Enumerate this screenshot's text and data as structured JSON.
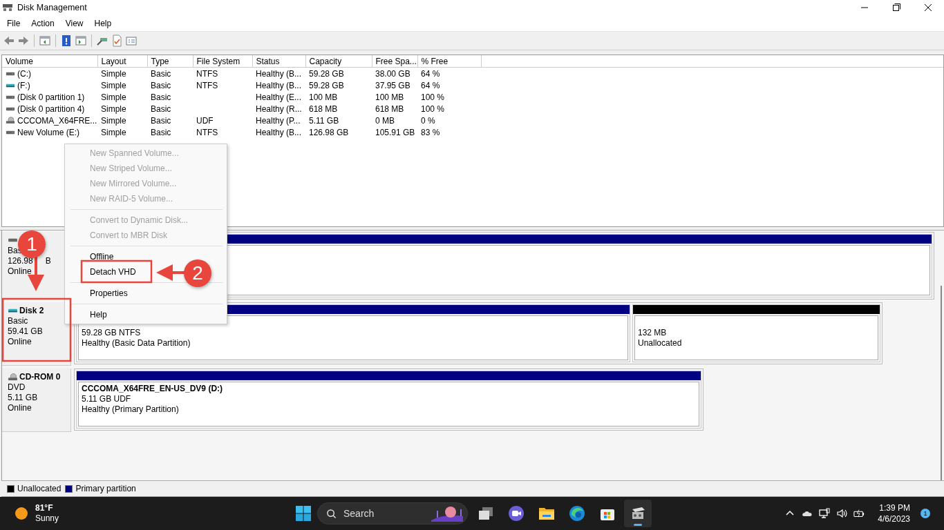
{
  "window": {
    "title": "Disk Management"
  },
  "menu": [
    "File",
    "Action",
    "View",
    "Help"
  ],
  "volumes": {
    "columns": [
      "Volume",
      "Layout",
      "Type",
      "File System",
      "Status",
      "Capacity",
      "Free Spa...",
      "% Free"
    ],
    "rows": [
      {
        "kind": "disk",
        "cells": [
          "(C:)",
          "Simple",
          "Basic",
          "NTFS",
          "Healthy (B...",
          "59.28 GB",
          "38.00 GB",
          "64 %"
        ]
      },
      {
        "kind": "vhd",
        "cells": [
          "(F:)",
          "Simple",
          "Basic",
          "NTFS",
          "Healthy (B...",
          "59.28 GB",
          "37.95 GB",
          "64 %"
        ]
      },
      {
        "kind": "disk",
        "cells": [
          "(Disk 0 partition 1)",
          "Simple",
          "Basic",
          "",
          "Healthy (E...",
          "100 MB",
          "100 MB",
          "100 %"
        ]
      },
      {
        "kind": "disk",
        "cells": [
          "(Disk 0 partition 4)",
          "Simple",
          "Basic",
          "",
          "Healthy (R...",
          "618 MB",
          "618 MB",
          "100 %"
        ]
      },
      {
        "kind": "cdrom",
        "cells": [
          "CCCOMA_X64FRE...",
          "Simple",
          "Basic",
          "UDF",
          "Healthy (P...",
          "5.11 GB",
          "0 MB",
          "0 %"
        ]
      },
      {
        "kind": "disk",
        "cells": [
          "New Volume (E:)",
          "Simple",
          "Basic",
          "NTFS",
          "Healthy (B...",
          "126.98 GB",
          "105.91 GB",
          "83 %"
        ]
      }
    ]
  },
  "disks": [
    {
      "kind": "disk",
      "lines": [
        "Bas",
        "126.98",
        "B",
        "Online"
      ],
      "partitions": [
        {
          "kind": "primary"
        }
      ]
    },
    {
      "kind": "vhd",
      "name": "Disk 2",
      "lines": [
        "Basic",
        "59.41 GB",
        "Online"
      ],
      "partitions": [
        {
          "kind": "primary",
          "lines": [
            "59.28 GB NTFS",
            "Healthy (Basic Data Partition)"
          ]
        },
        {
          "kind": "unallocated",
          "lines": [
            "132 MB",
            "Unallocated"
          ]
        }
      ]
    },
    {
      "kind": "cdrom",
      "name": "CD-ROM 0",
      "lines": [
        "DVD",
        "5.11 GB",
        "Online"
      ],
      "partitions": [
        {
          "kind": "primary",
          "title": "CCCOMA_X64FRE_EN-US_DV9  (D:)",
          "lines": [
            "5.11 GB UDF",
            "Healthy (Primary Partition)"
          ]
        }
      ]
    }
  ],
  "legend": [
    {
      "label": "Unallocated",
      "color": "#000000"
    },
    {
      "label": "Primary partition",
      "color": "#000080"
    }
  ],
  "context_menu": [
    {
      "kind": "item",
      "label": "New Spanned Volume...",
      "disabled": true
    },
    {
      "kind": "item",
      "label": "New Striped Volume...",
      "disabled": true
    },
    {
      "kind": "item",
      "label": "New Mirrored Volume...",
      "disabled": true
    },
    {
      "kind": "item",
      "label": "New RAID-5 Volume...",
      "disabled": true
    },
    {
      "kind": "separator"
    },
    {
      "kind": "item",
      "label": "Convert to Dynamic Disk...",
      "disabled": true
    },
    {
      "kind": "item",
      "label": "Convert to MBR Disk",
      "disabled": true
    },
    {
      "kind": "separator"
    },
    {
      "kind": "item",
      "label": "Offline",
      "disabled": false
    },
    {
      "kind": "item",
      "label": "Detach VHD",
      "disabled": false
    },
    {
      "kind": "separator"
    },
    {
      "kind": "item",
      "label": "Properties",
      "disabled": false
    },
    {
      "kind": "separator"
    },
    {
      "kind": "item",
      "label": "Help",
      "disabled": false
    }
  ],
  "annotations": [
    {
      "label": "1"
    },
    {
      "label": "2"
    }
  ],
  "taskbar": {
    "weather": {
      "temperature": "81°F",
      "condition": "Sunny"
    },
    "search": {
      "placeholder": "Search"
    },
    "apps": [
      {
        "kind": "taskview",
        "selected": false
      },
      {
        "kind": "chat",
        "selected": false
      },
      {
        "kind": "explorer",
        "selected": false
      },
      {
        "kind": "browser",
        "selected": false
      },
      {
        "kind": "store",
        "selected": false
      },
      {
        "kind": "diskmgmt",
        "selected": true
      }
    ],
    "time": "1:39 PM",
    "date": "4/6/2023",
    "notifications": "1"
  }
}
